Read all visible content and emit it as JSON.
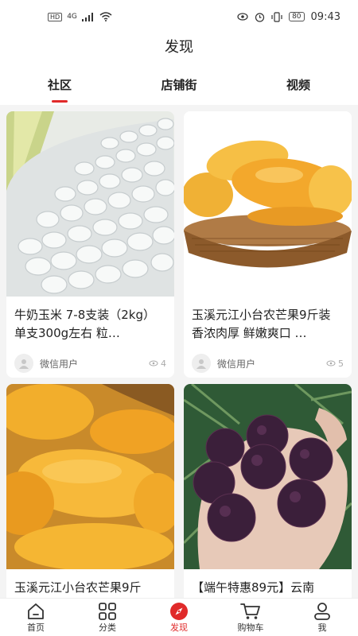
{
  "status_bar": {
    "network": "HD",
    "signal": "4G",
    "battery": "80",
    "time": "09:43"
  },
  "header": {
    "title": "发现"
  },
  "tabs": [
    {
      "label": "社区",
      "active": true
    },
    {
      "label": "店铺街",
      "active": false
    },
    {
      "label": "视频",
      "active": false
    }
  ],
  "posts": [
    {
      "title": "牛奶玉米 7-8支装（2kg）单支300g左右 粒…",
      "user": "微信用户",
      "views": "4",
      "image": "white-corn"
    },
    {
      "title": "玉溪元江小台农芒果9斤装 香浓肉厚 鲜嫩爽口 …",
      "user": "微信用户",
      "views": "5",
      "image": "mangoes-in-basket"
    },
    {
      "title": "玉溪元江小台农芒果9斤",
      "user": "",
      "views": "",
      "image": "mangoes-pile"
    },
    {
      "title": "【端午特惠89元】云南",
      "user": "",
      "views": "",
      "image": "bayberries-in-hand"
    }
  ],
  "bottom_nav": [
    {
      "label": "首页",
      "icon": "home-icon",
      "active": false
    },
    {
      "label": "分类",
      "icon": "category-icon",
      "active": false
    },
    {
      "label": "发现",
      "icon": "discover-icon",
      "active": true
    },
    {
      "label": "购物车",
      "icon": "cart-icon",
      "active": false
    },
    {
      "label": "我",
      "icon": "user-icon",
      "active": false
    }
  ],
  "colors": {
    "accent": "#e02a2a",
    "background": "#f4f4f4"
  }
}
